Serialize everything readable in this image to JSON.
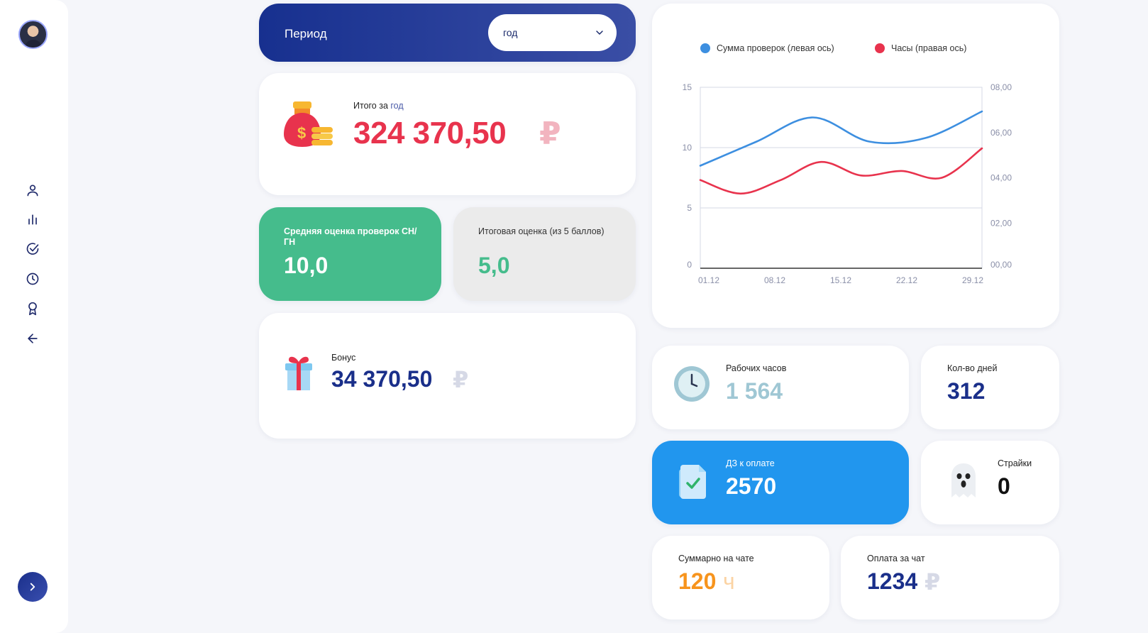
{
  "sidebar": {
    "nav": [
      "profile-icon",
      "bar-chart-icon",
      "check-circle-icon",
      "clock-icon",
      "award-icon",
      "arrow-left-icon"
    ],
    "expand": "chevron-right-icon"
  },
  "period": {
    "label": "Период",
    "selected": "год"
  },
  "total": {
    "label_prefix": "Итого за ",
    "label_highlight": "год",
    "value": "324 370,50",
    "currency": "₽"
  },
  "avg_score": {
    "label": "Средняя оценка проверок СН/ГН",
    "value": "10,0"
  },
  "final_score": {
    "label": "Итоговая оценка (из 5 баллов)",
    "value": "5,0"
  },
  "bonus": {
    "label": "Бонус",
    "value": "34 370,50",
    "currency": "₽"
  },
  "chart_data": {
    "type": "line",
    "x": [
      "01.12",
      "08.12",
      "15.12",
      "22.12",
      "29.12"
    ],
    "series": [
      {
        "name": "Сумма проверок (левая ось)",
        "axis": "left",
        "color": "#3d8fe0",
        "values": [
          8.5,
          10.5,
          12.5,
          10.5,
          10.8,
          13
        ]
      },
      {
        "name": "Часы (правая ось)",
        "axis": "right",
        "color": "#e8334d",
        "values": [
          3.9,
          3.3,
          3.9,
          4.7,
          4.1,
          4.3,
          4.0,
          5.3
        ]
      }
    ],
    "left_ticks": [
      "15",
      "10",
      "5",
      "0"
    ],
    "right_ticks": [
      "08,00",
      "06,00",
      "04,00",
      "02,00",
      "00,00"
    ],
    "ylim_left": [
      0,
      15
    ],
    "ylim_right": [
      0,
      8
    ],
    "grid": true,
    "legend": "top"
  },
  "hours": {
    "label": "Рабочих часов",
    "value": "1 564"
  },
  "days": {
    "label": "Кол-во дней",
    "value": "312"
  },
  "dz": {
    "label": "ДЗ к оплате",
    "value": "2570"
  },
  "strikes": {
    "label": "Страйки",
    "value": "0"
  },
  "chat_sum": {
    "label": "Суммарно на чате",
    "value": "120",
    "unit": "ч"
  },
  "chat_pay": {
    "label": "Оплата за чат",
    "value": "1234",
    "currency": "₽"
  },
  "colors": {
    "primary": "#1a2f8a",
    "accent_red": "#e8334d",
    "green": "#45bc8c",
    "blue": "#2196ee",
    "orange": "#f7941d"
  }
}
